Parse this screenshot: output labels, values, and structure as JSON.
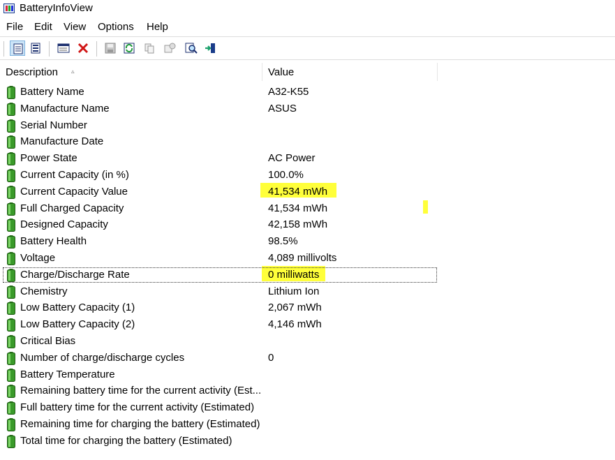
{
  "window": {
    "title": "BatteryInfoView"
  },
  "menu": [
    "File",
    "Edit",
    "View",
    "Options",
    "Help"
  ],
  "toolbar": {
    "buttons": [
      "properties-view-icon",
      "report-view-icon",
      "window-icon",
      "delete-icon",
      "save-icon",
      "refresh-icon",
      "copy-icon",
      "properties-icon",
      "find-icon",
      "exit-icon"
    ]
  },
  "columns": {
    "description": "Description",
    "value": "Value"
  },
  "rows": [
    {
      "desc": "Battery Name",
      "value": "A32-K55"
    },
    {
      "desc": "Manufacture Name",
      "value": "ASUS"
    },
    {
      "desc": "Serial Number",
      "value": ""
    },
    {
      "desc": "Manufacture Date",
      "value": ""
    },
    {
      "desc": "Power State",
      "value": "AC Power"
    },
    {
      "desc": "Current Capacity (in %)",
      "value": "100.0%"
    },
    {
      "desc": "Current Capacity Value",
      "value": "41,534 mWh"
    },
    {
      "desc": "Full Charged Capacity",
      "value": "41,534 mWh"
    },
    {
      "desc": "Designed Capacity",
      "value": "42,158 mWh"
    },
    {
      "desc": "Battery Health",
      "value": "98.5%"
    },
    {
      "desc": "Voltage",
      "value": "4,089 millivolts"
    },
    {
      "desc": "Charge/Discharge Rate",
      "value": "0 milliwatts"
    },
    {
      "desc": "Chemistry",
      "value": "Lithium Ion"
    },
    {
      "desc": "Low Battery Capacity (1)",
      "value": "2,067 mWh"
    },
    {
      "desc": "Low Battery Capacity (2)",
      "value": "4,146 mWh"
    },
    {
      "desc": "Critical Bias",
      "value": ""
    },
    {
      "desc": "Number of charge/discharge cycles",
      "value": "0"
    },
    {
      "desc": "Battery Temperature",
      "value": ""
    },
    {
      "desc": "Remaining battery time for the current activity (Est...",
      "value": ""
    },
    {
      "desc": "Full battery time for the current activity (Estimated)",
      "value": ""
    },
    {
      "desc": "Remaining time for charging the battery (Estimated)",
      "value": ""
    },
    {
      "desc": "Total  time for charging the battery (Estimated)",
      "value": ""
    }
  ],
  "colors": {
    "highlight": "#ffff3a",
    "battery": "#3a9a2a"
  }
}
